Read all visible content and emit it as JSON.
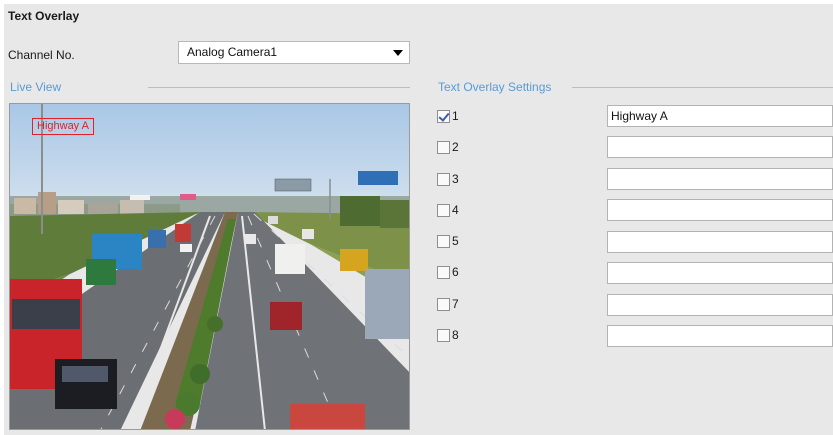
{
  "page": {
    "title": "Text Overlay"
  },
  "channel": {
    "label": "Channel No.",
    "selected": "Analog Camera1"
  },
  "live_view": {
    "label": "Live View",
    "osd_text": "Highway A"
  },
  "settings": {
    "label": "Text Overlay Settings",
    "rows": [
      {
        "number": "1",
        "checked": true,
        "value": "Highway A"
      },
      {
        "number": "2",
        "checked": false,
        "value": ""
      },
      {
        "number": "3",
        "checked": false,
        "value": ""
      },
      {
        "number": "4",
        "checked": false,
        "value": ""
      },
      {
        "number": "5",
        "checked": false,
        "value": ""
      },
      {
        "number": "6",
        "checked": false,
        "value": ""
      },
      {
        "number": "7",
        "checked": false,
        "value": ""
      },
      {
        "number": "8",
        "checked": false,
        "value": ""
      }
    ]
  },
  "colors": {
    "accent": "#5a9bd5",
    "osd": "#e0202a",
    "panel": "#e8e8e8"
  }
}
